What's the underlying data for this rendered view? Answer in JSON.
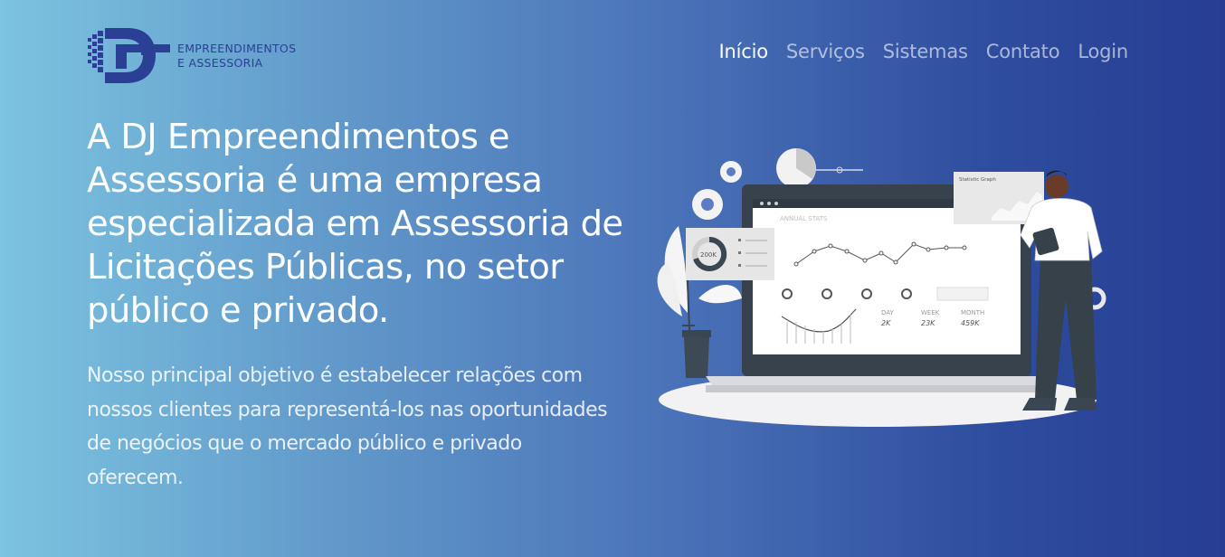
{
  "brand": {
    "line1": "EMPREENDIMENTOS",
    "line2": "E ASSESSORIA"
  },
  "nav": {
    "items": [
      {
        "label": "Início",
        "active": true
      },
      {
        "label": "Serviços",
        "active": false
      },
      {
        "label": "Sistemas",
        "active": false
      },
      {
        "label": "Contato",
        "active": false
      },
      {
        "label": "Login",
        "active": false
      }
    ]
  },
  "hero": {
    "title": "A DJ Empreendimentos e Assessoria é uma empresa especializada em Assessoria de Licitações Públicas, no setor público e privado.",
    "description": "Nosso principal objetivo é estabelecer relações com nossos clientes para representá-los nas oportunidades de negócios que o mercado público e privado oferecem."
  },
  "illustration": {
    "dashboard_title": "ANNUAL STATS",
    "donut_label": "200K",
    "panel_title": "Statistic Graph",
    "stats": [
      {
        "label": "DAY",
        "value": "2K"
      },
      {
        "label": "WEEK",
        "value": "23K"
      },
      {
        "label": "MONTH",
        "value": "459K"
      }
    ]
  },
  "colors": {
    "brand_blue": "#2b3f95",
    "gradient_start": "#7cc3e0",
    "gradient_end": "#263d93"
  }
}
